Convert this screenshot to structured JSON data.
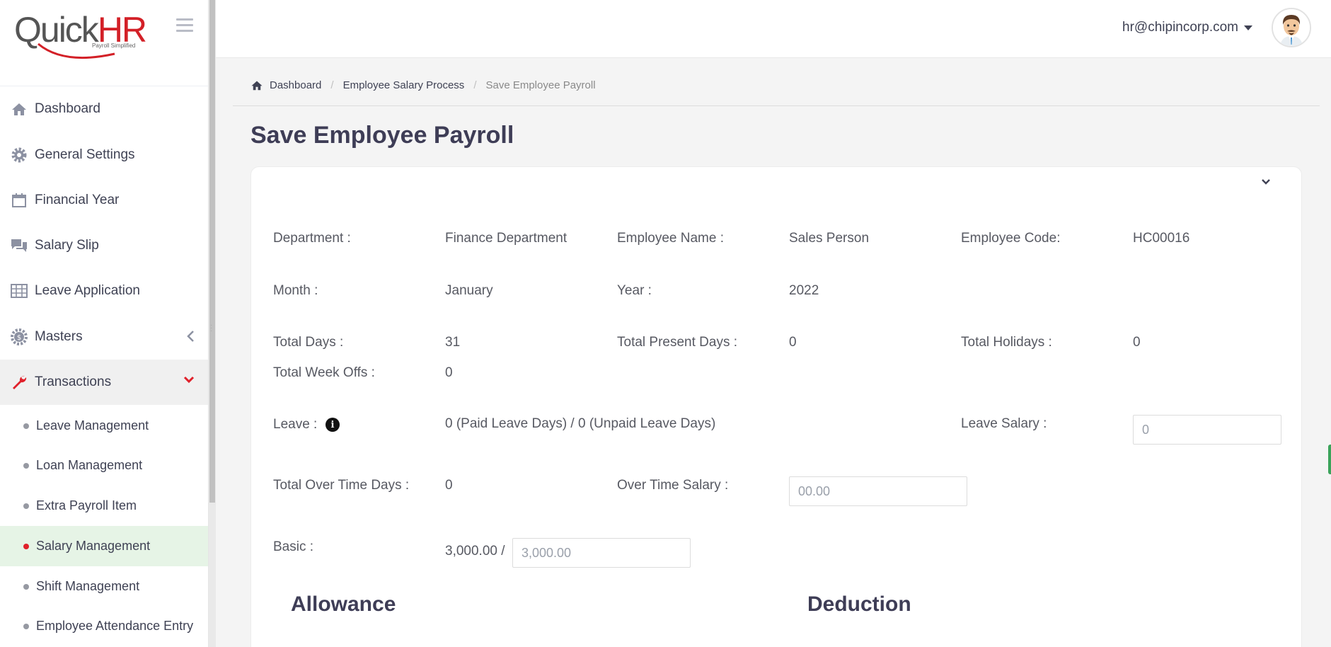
{
  "app": {
    "logo_prefix": "Quick",
    "logo_suffix": "HR",
    "tagline": "Payroll Simplified"
  },
  "sidebar": {
    "items": [
      {
        "label": "Dashboard",
        "icon": "home-icon"
      },
      {
        "label": "General Settings",
        "icon": "gear-icon"
      },
      {
        "label": "Financial Year",
        "icon": "calendar-icon"
      },
      {
        "label": "Salary Slip",
        "icon": "chat-icon"
      },
      {
        "label": "Leave Application",
        "icon": "table-icon"
      },
      {
        "label": "Masters",
        "icon": "money-icon"
      },
      {
        "label": "Transactions",
        "icon": "wrench-icon"
      }
    ],
    "sub_items": [
      {
        "label": "Leave Management"
      },
      {
        "label": "Loan Management"
      },
      {
        "label": "Extra Payroll Item"
      },
      {
        "label": "Salary Management"
      },
      {
        "label": "Shift Management"
      },
      {
        "label": "Employee Attendance Entry"
      }
    ]
  },
  "header": {
    "user_email": "hr@chipincorp.com"
  },
  "breadcrumb": {
    "home": "Dashboard",
    "parent": "Employee Salary Process",
    "current": "Save Employee Payroll"
  },
  "page": {
    "title": "Save Employee Payroll"
  },
  "form": {
    "department_label": "Department :",
    "department_value": "Finance Department",
    "employee_name_label": "Employee Name :",
    "employee_name_value": "Sales Person",
    "employee_code_label": "Employee Code:",
    "employee_code_value": "HC00016",
    "month_label": "Month :",
    "month_value": "January",
    "year_label": "Year :",
    "year_value": "2022",
    "total_days_label": "Total Days :",
    "total_days_value": "31",
    "total_present_label": "Total Present Days :",
    "total_present_value": "0",
    "total_holidays_label": "Total Holidays :",
    "total_holidays_value": "0",
    "total_weekoffs_label": "Total Week Offs :",
    "total_weekoffs_value": "0",
    "leave_label": "Leave :",
    "leave_value": "0 (Paid Leave Days) / 0 (Unpaid Leave Days)",
    "leave_salary_label": "Leave Salary :",
    "leave_salary_placeholder": "0",
    "overtime_days_label": "Total Over Time Days :",
    "overtime_days_value": "0",
    "overtime_salary_label": "Over Time Salary :",
    "overtime_salary_placeholder": "00.00",
    "basic_label": "Basic :",
    "basic_value": "3,000.00 /",
    "basic_placeholder": "3,000.00"
  },
  "sections": {
    "allowance": "Allowance",
    "deduction": "Deduction"
  },
  "colors": {
    "accent_red": "#e0212b",
    "active_sub_bg": "#e6f4e6",
    "title": "#3e3d56"
  }
}
